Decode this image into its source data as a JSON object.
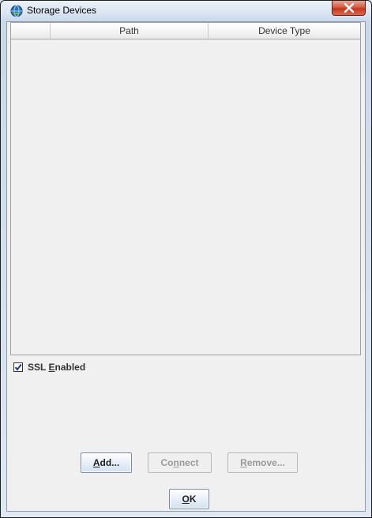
{
  "window": {
    "title": "Storage Devices",
    "icon": "storage-globe-icon",
    "close_icon": "close-x-icon"
  },
  "table": {
    "columns": [
      "",
      "Path",
      "Device Type"
    ],
    "rows": []
  },
  "ssl": {
    "label_before": "SSL ",
    "label_mnemonic": "E",
    "label_after": "nabled",
    "checked": true
  },
  "buttons": {
    "add": {
      "before": "",
      "mnemonic": "A",
      "after": "dd..."
    },
    "connect": {
      "before": "Co",
      "mnemonic": "n",
      "after": "nect"
    },
    "remove": {
      "before": "",
      "mnemonic": "R",
      "after": "emove..."
    },
    "ok": {
      "before": "",
      "mnemonic": "O",
      "after": "K"
    }
  },
  "colors": {
    "close_button": "#c4361d",
    "disabled_text": "#9a9a9a"
  }
}
